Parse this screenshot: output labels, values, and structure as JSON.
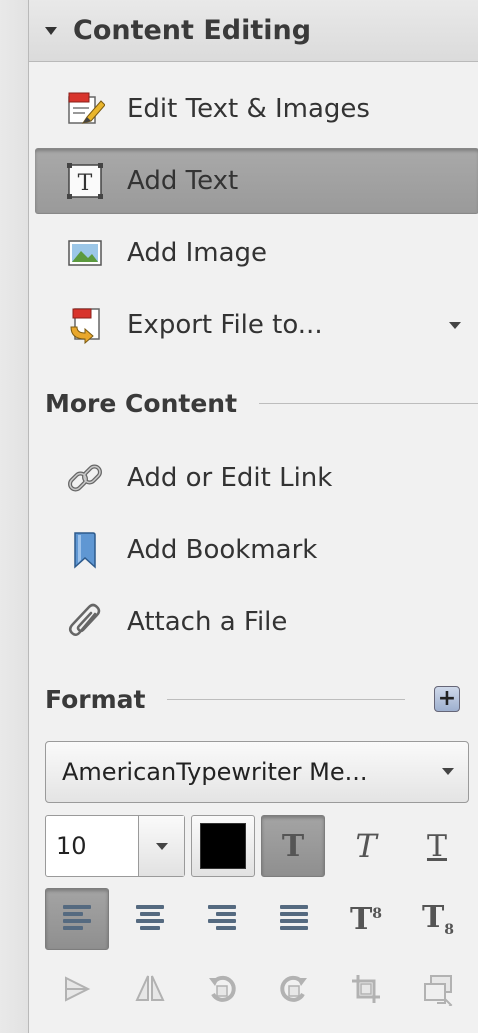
{
  "section": {
    "title": "Content Editing"
  },
  "tools": [
    {
      "label": "Edit Text & Images",
      "icon": "edit-text-images-icon"
    },
    {
      "label": "Add Text",
      "icon": "add-text-icon"
    },
    {
      "label": "Add Image",
      "icon": "add-image-icon"
    },
    {
      "label": "Export File to...",
      "icon": "export-file-icon"
    }
  ],
  "more_content": {
    "title": "More Content",
    "items": [
      {
        "label": "Add or Edit Link",
        "icon": "link-icon"
      },
      {
        "label": "Add Bookmark",
        "icon": "bookmark-icon"
      },
      {
        "label": "Attach a File",
        "icon": "paperclip-icon"
      }
    ]
  },
  "format": {
    "title": "Format",
    "font_name": "AmericanTypewriter Me...",
    "font_size": "10",
    "text_color": "#000000",
    "style_bold_glyph": "T",
    "style_italic_glyph": "T",
    "style_underline_glyph": "T",
    "superscript_glyph": "T",
    "superscript_mark": "8",
    "subscript_glyph": "T",
    "subscript_mark": "8"
  }
}
